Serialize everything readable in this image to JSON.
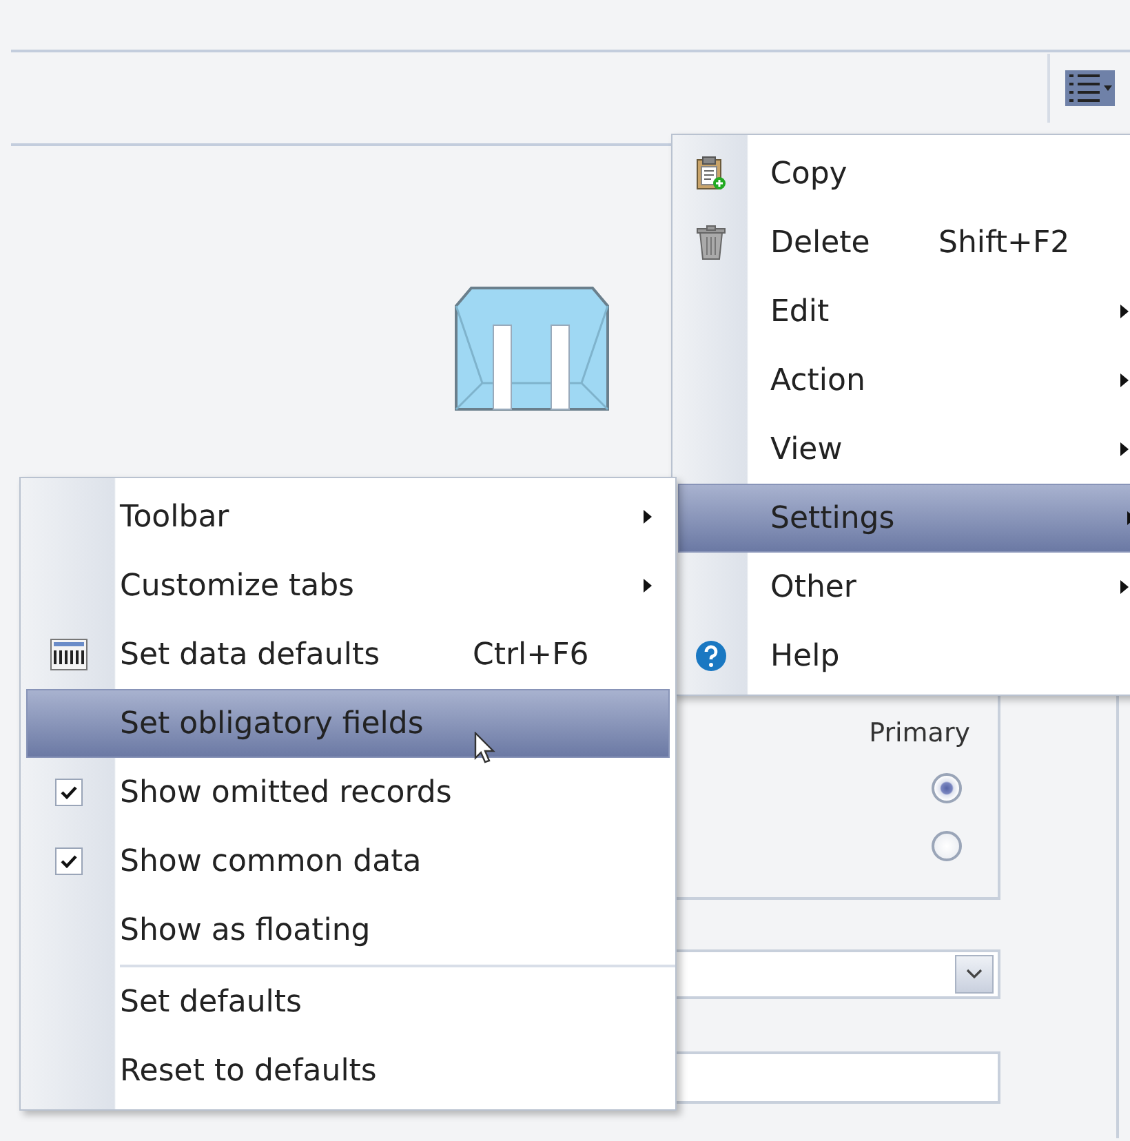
{
  "toolbar": {
    "menu_button": {
      "expanded": true
    }
  },
  "record_panel": {
    "column_label": "Primary",
    "radios": [
      {
        "selected": true
      },
      {
        "selected": false
      }
    ]
  },
  "main_menu": {
    "items": [
      {
        "label": "Copy",
        "kind": "item",
        "selected": false
      },
      {
        "label": "Delete",
        "kind": "item",
        "shortcut": "Shift+F2",
        "selected": false
      },
      {
        "label": "Edit",
        "kind": "submenu",
        "selected": false
      },
      {
        "label": "Action",
        "kind": "submenu",
        "selected": false
      },
      {
        "label": "View",
        "kind": "submenu",
        "selected": false
      },
      {
        "label": "Settings",
        "kind": "submenu",
        "selected": true
      },
      {
        "label": "Other",
        "kind": "submenu",
        "selected": false
      },
      {
        "label": "Help",
        "kind": "item",
        "selected": false
      }
    ]
  },
  "settings_menu": {
    "items": [
      {
        "label": "Toolbar",
        "kind": "submenu",
        "checked": false,
        "selected": false
      },
      {
        "label": "Customize tabs",
        "kind": "submenu",
        "checked": false,
        "selected": false
      },
      {
        "label": "Set data defaults",
        "kind": "item",
        "shortcut": "Ctrl+F6",
        "checked": false,
        "selected": false
      },
      {
        "label": "Set obligatory fields",
        "kind": "item",
        "checked": false,
        "selected": true
      },
      {
        "label": "Show omitted records",
        "kind": "item",
        "checked": true,
        "selected": false
      },
      {
        "label": "Show common data",
        "kind": "item",
        "checked": true,
        "selected": false
      },
      {
        "label": "Show as floating",
        "kind": "item",
        "checked": false,
        "selected": false
      },
      {
        "label": "Set defaults",
        "kind": "item",
        "checked": false,
        "selected": false,
        "separator_before": true
      },
      {
        "label": "Reset to defaults",
        "kind": "item",
        "checked": false,
        "selected": false
      }
    ]
  }
}
